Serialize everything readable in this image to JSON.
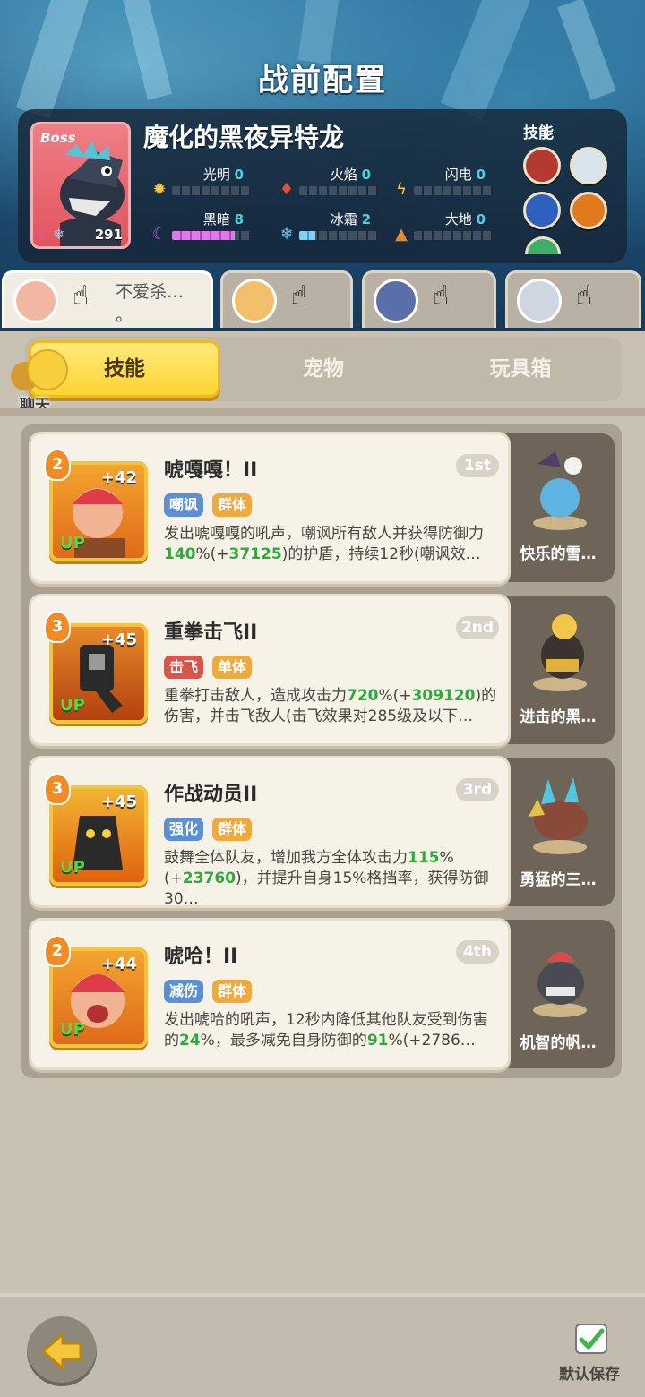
{
  "page_title": "战前配置",
  "boss": {
    "tag": "Boss",
    "name": "魔化的黑夜异特龙",
    "level": "291",
    "elements": [
      {
        "label": "光明",
        "value": "0",
        "icon": "sun-icon",
        "color": "#f3c43c",
        "progress": 0
      },
      {
        "label": "火焰",
        "value": "0",
        "icon": "fire-icon",
        "color": "#e54b3a",
        "progress": 0
      },
      {
        "label": "闪电",
        "value": "0",
        "icon": "lightning-icon",
        "color": "#f3c43c",
        "progress": 0
      },
      {
        "label": "黑暗",
        "value": "8",
        "icon": "moon-icon",
        "color": "#c65ad8",
        "progress": 0.8
      },
      {
        "label": "冰霜",
        "value": "2",
        "icon": "snowflake-icon",
        "color": "#6cc3f2",
        "progress": 0.2
      },
      {
        "label": "大地",
        "value": "0",
        "icon": "earth-icon",
        "color": "#e08a3a",
        "progress": 0
      }
    ],
    "skills_label": "技能"
  },
  "team": [
    {
      "name": "不爱杀…",
      "name2": "。",
      "active": true
    },
    {
      "name": "",
      "active": false
    },
    {
      "name": "",
      "active": false
    },
    {
      "name": "",
      "active": false
    }
  ],
  "tabs": {
    "skills": "技能",
    "pets": "宠物",
    "toybox": "玩具箱"
  },
  "chat_label": "聊天",
  "skills": [
    {
      "level": "2",
      "plus": "+42",
      "up": "UP",
      "title": "唬嘎嘎！II",
      "rank": "1st",
      "tags": [
        {
          "text": "嘲讽",
          "color": "#5b8fd6"
        },
        {
          "text": "群体",
          "color": "#f0a93c"
        }
      ],
      "desc_pre": "发出唬嘎嘎的吼声，嘲讽所有敌人并获得防御力",
      "desc_g1": "140",
      "desc_mid": "%(+",
      "desc_g2": "37125",
      "desc_post": ")的护盾，持续12秒(嘲讽效…",
      "pet_name": "快乐的雪…"
    },
    {
      "level": "3",
      "plus": "+45",
      "up": "UP",
      "title": "重拳击飞II",
      "rank": "2nd",
      "tags": [
        {
          "text": "击飞",
          "color": "#d9544a"
        },
        {
          "text": "单体",
          "color": "#f0a93c"
        }
      ],
      "desc_pre": "重拳打击敌人，造成攻击力",
      "desc_g1": "720",
      "desc_mid": "%(+",
      "desc_g2": "309120",
      "desc_post": ")的伤害，并击飞敌人(击飞效果对285级及以下…",
      "pet_name": "进击的黑…"
    },
    {
      "level": "3",
      "plus": "+45",
      "up": "UP",
      "title": "作战动员II",
      "rank": "3rd",
      "tags": [
        {
          "text": "强化",
          "color": "#5b8fd6"
        },
        {
          "text": "群体",
          "color": "#f0a93c"
        }
      ],
      "desc_pre": "鼓舞全体队友，增加我方全体攻击力",
      "desc_g1": "115",
      "desc_mid": "%(+",
      "desc_g2": "23760",
      "desc_post": ")，并提升自身15%格挡率，获得防御30…",
      "pet_name": "勇猛的三…"
    },
    {
      "level": "2",
      "plus": "+44",
      "up": "UP",
      "title": "唬哈！II",
      "rank": "4th",
      "tags": [
        {
          "text": "减伤",
          "color": "#5b8fd6"
        },
        {
          "text": "群体",
          "color": "#f0a93c"
        }
      ],
      "desc_pre": "发出唬哈的吼声，12秒内降低其他队友受到伤害的",
      "desc_g1": "24",
      "desc_mid": "%，最多减免自身防御的",
      "desc_g2": "91",
      "desc_post": "%(+2786…",
      "pet_name": "机智的帆…"
    }
  ],
  "save_label": "默认保存"
}
